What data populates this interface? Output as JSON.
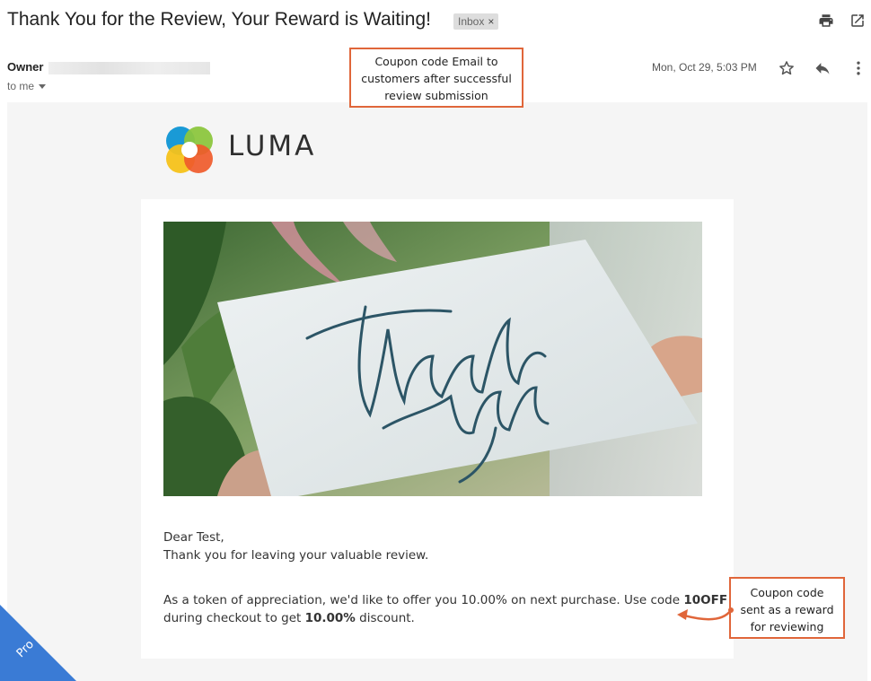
{
  "email": {
    "subject": "Thank You for the Review, Your Reward is Waiting!",
    "label_chip": "Inbox",
    "label_chip_close": "×",
    "sender_name": "Owner",
    "recipient_text": "to me",
    "date": "Mon, Oct 29, 5:03 PM"
  },
  "icons": {
    "print": "print-icon",
    "open_new_window": "open-in-new-window-icon",
    "star": "star-icon",
    "reply": "reply-icon",
    "more": "more-vertical-icon",
    "expand_recipients": "chevron-down-icon"
  },
  "annotations": {
    "top_note_lines": [
      "Coupon code Email to",
      "customers after successful",
      "review submission"
    ],
    "side_note_lines": [
      "Coupon code",
      "sent as a reward",
      "for reviewing"
    ],
    "note_border_color": "#e0663a"
  },
  "body": {
    "brand_name": "LUMA",
    "greeting": "Dear Test,",
    "thanks_line": "Thank you for leaving your valuable review.",
    "offer_part1": "As a token of appreciation, we'd like to offer you 10.00% on next purchase. Use code ",
    "coupon_code": "10OFF",
    "offer_part2": "during checkout to get ",
    "discount_value": "10.00%",
    "offer_part3": " discount.",
    "hero_card_text": "Thank you"
  },
  "badge": {
    "label": "Pro",
    "color": "#3a7bd5"
  }
}
